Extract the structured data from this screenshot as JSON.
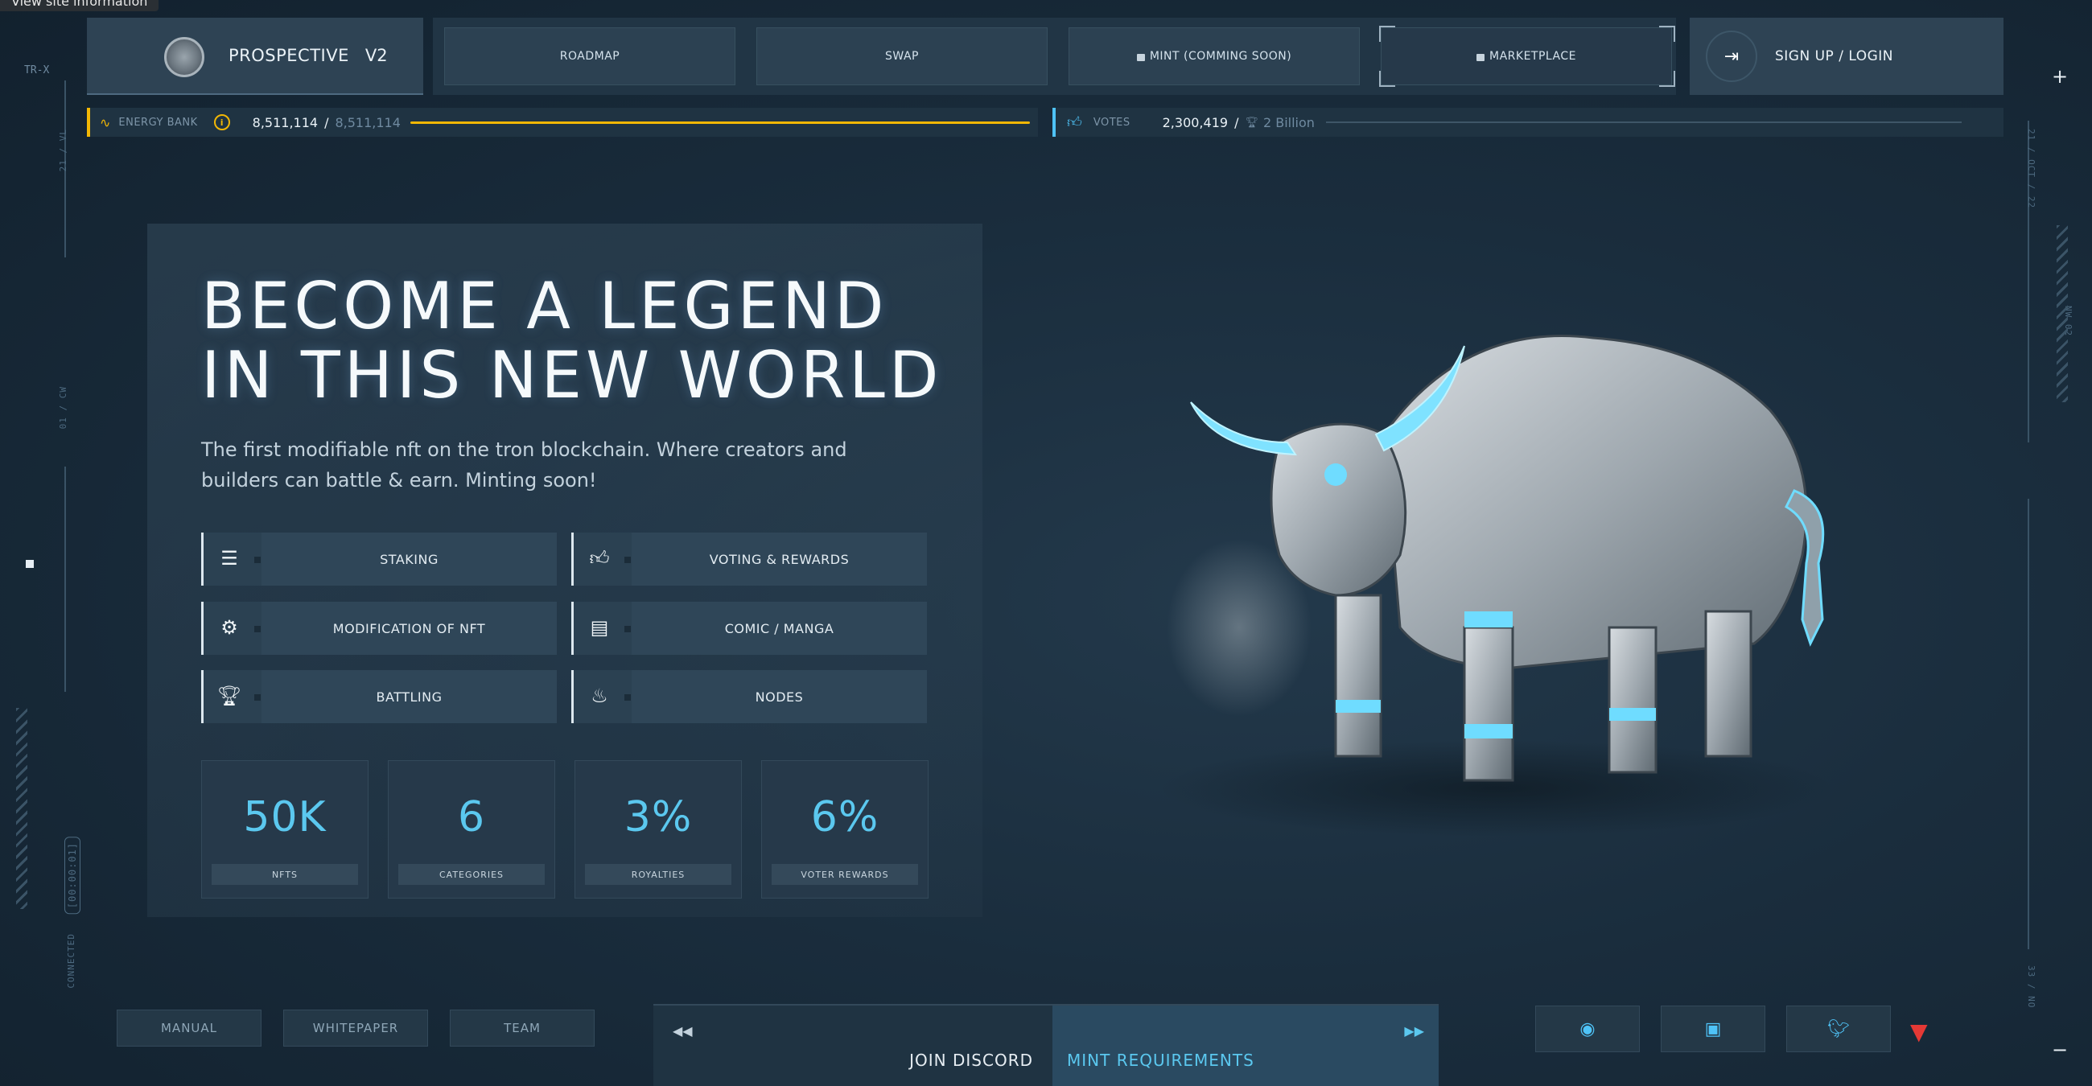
{
  "tooltip": "View site information",
  "frame": {
    "left_code": "TR-X",
    "left_vl": "21 / VL",
    "left_cw": "01 / CW",
    "left_timer": "[00:00:01]",
    "left_connected": "CONNECTED",
    "right_date": "21 / OCT / 22",
    "right_nw": "NW 02",
    "right_no": "33 / NO"
  },
  "brand": {
    "name": "PROSPECTIVE",
    "version": "V2"
  },
  "nav": {
    "roadmap": "ROADMAP",
    "swap": "SWAP",
    "mint": "MINT (COMMING SOON)",
    "marketplace": "MARKETPLACE"
  },
  "auth": {
    "label": "SIGN UP / LOGIN"
  },
  "energy": {
    "label": "ENERGY BANK",
    "value": "8,511,114",
    "sep": "/",
    "max": "8,511,114",
    "fill": 1.0
  },
  "votes": {
    "label": "VOTES",
    "value": "2,300,419",
    "sep": "/",
    "max": "2 Billion",
    "fill": 0.0012
  },
  "hero": {
    "title_line1": "BECOME A LEGEND",
    "title_line2": "IN THIS NEW WORLD",
    "subtitle": "The first modifiable nft on the tron blockchain. Where creators and builders can battle & earn. Minting soon!"
  },
  "features": [
    {
      "label": "STAKING",
      "icon": "database-icon"
    },
    {
      "label": "VOTING & REWARDS",
      "icon": "thumbs-up-icon"
    },
    {
      "label": "MODIFICATION OF NFT",
      "icon": "gear-icon"
    },
    {
      "label": "COMIC / MANGA",
      "icon": "book-icon"
    },
    {
      "label": "BATTLING",
      "icon": "trophy-icon"
    },
    {
      "label": "NODES",
      "icon": "flame-icon"
    }
  ],
  "stats": [
    {
      "value": "50K",
      "caption": "NFTS"
    },
    {
      "value": "6",
      "caption": "CATEGORIES"
    },
    {
      "value": "3%",
      "caption": "ROYALTIES"
    },
    {
      "value": "6%",
      "caption": "VOTER REWARDS"
    }
  ],
  "footer": {
    "manual": "MANUAL",
    "whitepaper": "WHITEPAPER",
    "team": "TEAM",
    "join_discord": "JOIN DISCORD",
    "mint_requirements": "MINT REQUIREMENTS"
  },
  "social": [
    "discord-icon",
    "instagram-icon",
    "twitter-icon",
    "tron-icon"
  ],
  "colors": {
    "accent": "#5bc8ef",
    "energy": "#f2b705",
    "tron": "#e53935"
  }
}
